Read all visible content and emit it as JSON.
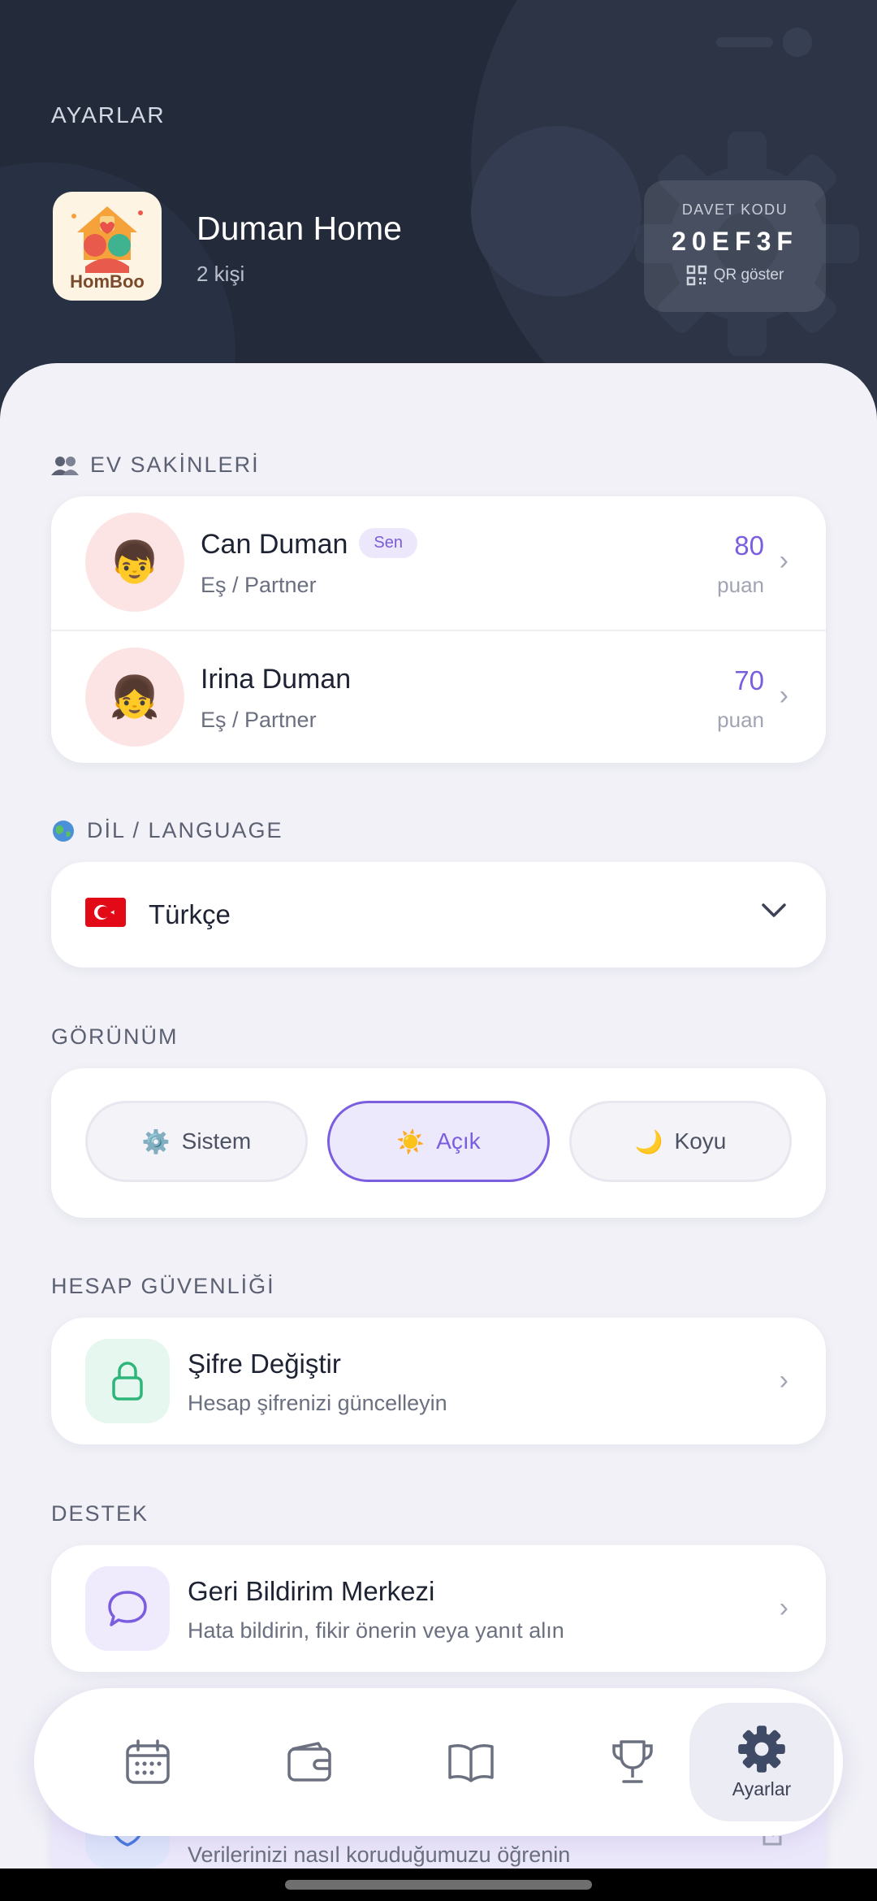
{
  "header": {
    "title": "AYARLAR",
    "home_name": "Duman Home",
    "member_count": "2 kişi",
    "logo_text": "HomBoo",
    "invite": {
      "label": "DAVET KODU",
      "code": "20EF3F",
      "qr_label": "QR göster"
    }
  },
  "members": {
    "section_label": "EV SAKİNLERİ",
    "items": [
      {
        "name": "Can Duman",
        "badge": "Sen",
        "role": "Eş / Partner",
        "points": "80",
        "points_unit": "puan",
        "avatar": "👦"
      },
      {
        "name": "Irina Duman",
        "role": "Eş / Partner",
        "points": "70",
        "points_unit": "puan",
        "avatar": "👧"
      }
    ]
  },
  "language": {
    "section_label": "DİL / LANGUAGE",
    "selected": "Türkçe",
    "flag": "turkey-flag"
  },
  "appearance": {
    "section_label": "GÖRÜNÜM",
    "options": [
      {
        "label": "Sistem",
        "icon": "⚙️"
      },
      {
        "label": "Açık",
        "icon": "☀️"
      },
      {
        "label": "Koyu",
        "icon": "🌙"
      }
    ],
    "selected": "Açık"
  },
  "security": {
    "section_label": "HESAP GÜVENLİĞİ",
    "change_password": {
      "title": "Şifre Değiştir",
      "subtitle": "Hesap şifrenizi güncelleyin"
    }
  },
  "support": {
    "section_label": "DESTEK",
    "feedback": {
      "title": "Geri Bildirim Merkezi",
      "subtitle": "Hata bildirin, fikir önerin veya yanıt alın"
    },
    "privacy_partial": {
      "subtitle": "Verilerinizi nasıl koruduğumuzu öğrenin"
    }
  },
  "nav": {
    "items": [
      "calendar-icon",
      "wallet-icon",
      "book-icon",
      "trophy-icon",
      "gear-icon"
    ],
    "active_label": "Ayarlar"
  },
  "colors": {
    "accent": "#7b5ee0",
    "header_bg": "#232b3b",
    "page_bg": "#f1f1f7"
  }
}
